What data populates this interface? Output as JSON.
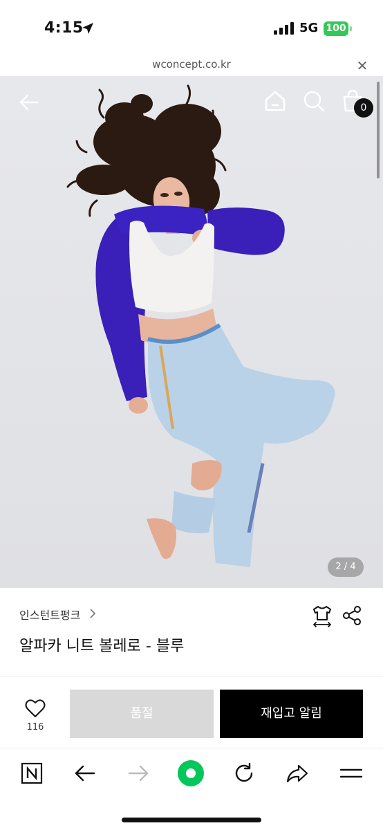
{
  "status_bar": {
    "time": "4:15",
    "network": "5G",
    "battery": "100"
  },
  "browser": {
    "url": "wconcept.co.kr"
  },
  "hero": {
    "image_counter": "2 / 4",
    "cart_count": "0"
  },
  "product": {
    "brand": "인스턴트펑크",
    "title": "알파카 니트 볼레로 - 블루"
  },
  "actions": {
    "like_count": "116",
    "soldout_label": "품절",
    "notify_label": "재입고 알림"
  },
  "colors": {
    "battery": "#34c759",
    "naver_green": "#03c75a",
    "knit_blue": "#3a1fb8",
    "notify_button": "#000000",
    "soldout_button": "#d9d9d9"
  },
  "icons": {
    "toolbar": [
      "naver-n-icon",
      "back-arrow-icon",
      "forward-arrow-icon",
      "naver-green-dot-icon",
      "refresh-icon",
      "share-arrow-icon",
      "menu-icon"
    ]
  }
}
